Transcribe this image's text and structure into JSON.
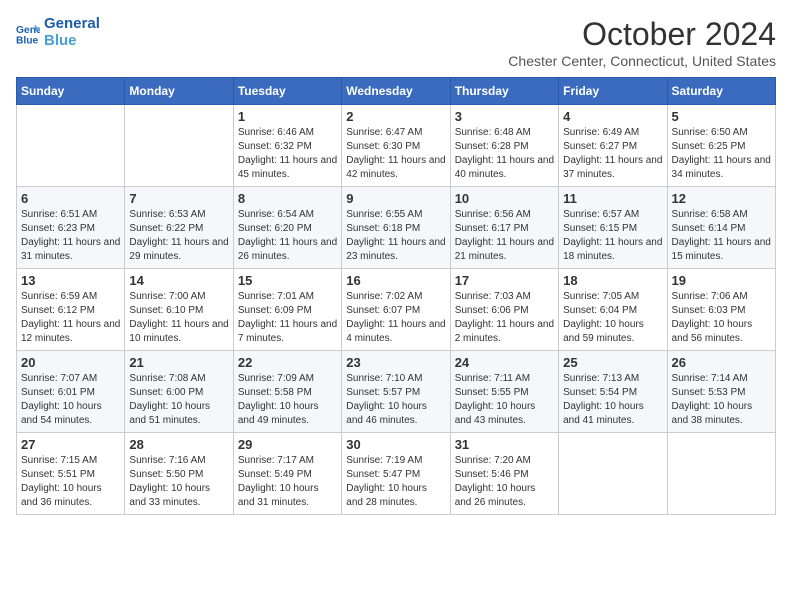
{
  "header": {
    "logo_line1": "General",
    "logo_line2": "Blue",
    "month_year": "October 2024",
    "location": "Chester Center, Connecticut, United States"
  },
  "days_of_week": [
    "Sunday",
    "Monday",
    "Tuesday",
    "Wednesday",
    "Thursday",
    "Friday",
    "Saturday"
  ],
  "weeks": [
    [
      {
        "day": "",
        "text": ""
      },
      {
        "day": "",
        "text": ""
      },
      {
        "day": "1",
        "text": "Sunrise: 6:46 AM\nSunset: 6:32 PM\nDaylight: 11 hours and 45 minutes."
      },
      {
        "day": "2",
        "text": "Sunrise: 6:47 AM\nSunset: 6:30 PM\nDaylight: 11 hours and 42 minutes."
      },
      {
        "day": "3",
        "text": "Sunrise: 6:48 AM\nSunset: 6:28 PM\nDaylight: 11 hours and 40 minutes."
      },
      {
        "day": "4",
        "text": "Sunrise: 6:49 AM\nSunset: 6:27 PM\nDaylight: 11 hours and 37 minutes."
      },
      {
        "day": "5",
        "text": "Sunrise: 6:50 AM\nSunset: 6:25 PM\nDaylight: 11 hours and 34 minutes."
      }
    ],
    [
      {
        "day": "6",
        "text": "Sunrise: 6:51 AM\nSunset: 6:23 PM\nDaylight: 11 hours and 31 minutes."
      },
      {
        "day": "7",
        "text": "Sunrise: 6:53 AM\nSunset: 6:22 PM\nDaylight: 11 hours and 29 minutes."
      },
      {
        "day": "8",
        "text": "Sunrise: 6:54 AM\nSunset: 6:20 PM\nDaylight: 11 hours and 26 minutes."
      },
      {
        "day": "9",
        "text": "Sunrise: 6:55 AM\nSunset: 6:18 PM\nDaylight: 11 hours and 23 minutes."
      },
      {
        "day": "10",
        "text": "Sunrise: 6:56 AM\nSunset: 6:17 PM\nDaylight: 11 hours and 21 minutes."
      },
      {
        "day": "11",
        "text": "Sunrise: 6:57 AM\nSunset: 6:15 PM\nDaylight: 11 hours and 18 minutes."
      },
      {
        "day": "12",
        "text": "Sunrise: 6:58 AM\nSunset: 6:14 PM\nDaylight: 11 hours and 15 minutes."
      }
    ],
    [
      {
        "day": "13",
        "text": "Sunrise: 6:59 AM\nSunset: 6:12 PM\nDaylight: 11 hours and 12 minutes."
      },
      {
        "day": "14",
        "text": "Sunrise: 7:00 AM\nSunset: 6:10 PM\nDaylight: 11 hours and 10 minutes."
      },
      {
        "day": "15",
        "text": "Sunrise: 7:01 AM\nSunset: 6:09 PM\nDaylight: 11 hours and 7 minutes."
      },
      {
        "day": "16",
        "text": "Sunrise: 7:02 AM\nSunset: 6:07 PM\nDaylight: 11 hours and 4 minutes."
      },
      {
        "day": "17",
        "text": "Sunrise: 7:03 AM\nSunset: 6:06 PM\nDaylight: 11 hours and 2 minutes."
      },
      {
        "day": "18",
        "text": "Sunrise: 7:05 AM\nSunset: 6:04 PM\nDaylight: 10 hours and 59 minutes."
      },
      {
        "day": "19",
        "text": "Sunrise: 7:06 AM\nSunset: 6:03 PM\nDaylight: 10 hours and 56 minutes."
      }
    ],
    [
      {
        "day": "20",
        "text": "Sunrise: 7:07 AM\nSunset: 6:01 PM\nDaylight: 10 hours and 54 minutes."
      },
      {
        "day": "21",
        "text": "Sunrise: 7:08 AM\nSunset: 6:00 PM\nDaylight: 10 hours and 51 minutes."
      },
      {
        "day": "22",
        "text": "Sunrise: 7:09 AM\nSunset: 5:58 PM\nDaylight: 10 hours and 49 minutes."
      },
      {
        "day": "23",
        "text": "Sunrise: 7:10 AM\nSunset: 5:57 PM\nDaylight: 10 hours and 46 minutes."
      },
      {
        "day": "24",
        "text": "Sunrise: 7:11 AM\nSunset: 5:55 PM\nDaylight: 10 hours and 43 minutes."
      },
      {
        "day": "25",
        "text": "Sunrise: 7:13 AM\nSunset: 5:54 PM\nDaylight: 10 hours and 41 minutes."
      },
      {
        "day": "26",
        "text": "Sunrise: 7:14 AM\nSunset: 5:53 PM\nDaylight: 10 hours and 38 minutes."
      }
    ],
    [
      {
        "day": "27",
        "text": "Sunrise: 7:15 AM\nSunset: 5:51 PM\nDaylight: 10 hours and 36 minutes."
      },
      {
        "day": "28",
        "text": "Sunrise: 7:16 AM\nSunset: 5:50 PM\nDaylight: 10 hours and 33 minutes."
      },
      {
        "day": "29",
        "text": "Sunrise: 7:17 AM\nSunset: 5:49 PM\nDaylight: 10 hours and 31 minutes."
      },
      {
        "day": "30",
        "text": "Sunrise: 7:19 AM\nSunset: 5:47 PM\nDaylight: 10 hours and 28 minutes."
      },
      {
        "day": "31",
        "text": "Sunrise: 7:20 AM\nSunset: 5:46 PM\nDaylight: 10 hours and 26 minutes."
      },
      {
        "day": "",
        "text": ""
      },
      {
        "day": "",
        "text": ""
      }
    ]
  ]
}
